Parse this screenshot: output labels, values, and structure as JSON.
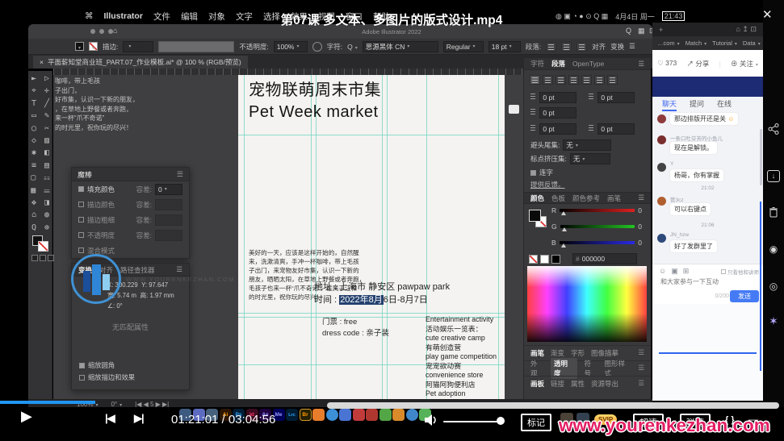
{
  "menubar": {
    "apple_icon": "⌘",
    "items": [
      "Illustrator",
      "文件",
      "编辑",
      "对象",
      "文字",
      "选择",
      "效果",
      "视图",
      "窗口",
      "帮助"
    ],
    "status_icons": "◍ ▣ ◔ ● ⊙ Q ▦",
    "status_date": "4月4日 周一",
    "status_time": "21:43"
  },
  "video": {
    "title": "第07课 多文本、多图片的版式设计.mp4",
    "app_caption": "Adobe Illustrator 2022",
    "close_icon": "✕",
    "current_time": "01:21:01",
    "time_separator": "/",
    "duration": "03:04:56",
    "marker_button": "标记",
    "svip_badge": "SVIP",
    "quality_button": "超清",
    "danmaku_button": "弹幕",
    "code_icon": "{ }",
    "minimize_icon": "—",
    "watermark": "www.yourenkezhan.com"
  },
  "player": {
    "play_icon": "▶",
    "prev_icon": "|◀",
    "next_icon": "▶|"
  },
  "illustrator": {
    "window": {
      "home_icon": "⌂",
      "search_icon": "Q",
      "layout_icon1": "▦",
      "layout_icon2": "⊡"
    },
    "control_bar": {
      "stroke_label": "描边:",
      "opacity_label": "不透明度:",
      "opacity_value": "100%",
      "char_label": "字符:",
      "font_search_icon": "Q",
      "font_name": "思源黑体 CN",
      "font_style": "Regular",
      "font_size": "18 pt",
      "paragraph_label": "段落:",
      "align_label": "对齐",
      "transform_label": "变换",
      "menu_icon": "☰"
    },
    "doc_tab": {
      "close_icon": "×",
      "title": "平面薪知堂商业班_PART.07_作业模板.ai* @ 100 % (RGB/预览)"
    },
    "tools_glyphs": "► ▷ ⌖ ✛ T ╱ ▭ ✎ ◯ ✂ ◇ ▨ ✱ ◧ ≡ ▤ ▢ ☷ ▦ ☰ ✥ ◨ ⌂ ◍ Q ⊕",
    "status_bar": {
      "zoom": "100%",
      "rotation": "0°",
      "artboard_nav": "|◀ ◀ 5 ▶ ▶|"
    },
    "magic_wand_panel": {
      "title": "魔棒",
      "rows": [
        {
          "label": "填充颜色",
          "field": "容差:",
          "value": "0"
        },
        {
          "label": "描边颜色",
          "field": "容差:"
        },
        {
          "label": "描边粗细",
          "field": "容差:"
        },
        {
          "label": "不透明度",
          "field": "容差:"
        },
        {
          "label": "混合模式"
        }
      ]
    },
    "transform_panel": {
      "tabs": [
        "变换",
        "对齐",
        "路径查找器"
      ],
      "x_label": "X:",
      "x_value": "300.229",
      "y_label": "Y:",
      "y_value": "97.647",
      "w_label": "宽:",
      "w_value": "5.74 m",
      "h_label": "高:",
      "h_value": "1.97 mm",
      "angle_label": "∠:",
      "angle_value": "0°",
      "empty_text": "无匹配属性",
      "scale_corners": "缩放圆角",
      "scale_strokes": "缩放描边和效果"
    },
    "paragraph_panel": {
      "tabs": [
        "字符",
        "段落",
        "OpenType"
      ],
      "indent_left": "0 pt",
      "indent_right": "0 pt",
      "indent_first": "0 pt",
      "space_before": "0 pt",
      "space_after": "0 pt",
      "kinsoku_label": "避头尾集:",
      "kinsoku_value": "无",
      "mojikumi_label": "标点挤压集:",
      "mojikumi_value": "无",
      "hyphenate_label": "连字",
      "feedback_link": "提供反馈。"
    },
    "color_panel": {
      "tabs": [
        "颜色",
        "色板",
        "颜色参考",
        "画笔"
      ],
      "channels": [
        {
          "label": "R",
          "value": "0"
        },
        {
          "label": "G",
          "value": "0"
        },
        {
          "label": "B",
          "value": "0"
        }
      ],
      "hex_prefix": "#",
      "hex_value": "000000"
    },
    "panel_tab_rows": [
      [
        "画笔",
        "渐变",
        "字形",
        "图像描摹"
      ],
      [
        "外观",
        "透明度",
        "符号",
        "图形样式"
      ],
      [
        "画板",
        "链接",
        "属性",
        "资源导出"
      ]
    ]
  },
  "artboard": {
    "title_line1": "宠物联萌周末市集",
    "title_line2": "Pet Week market",
    "paragraph": [
      "美好的一天，应该是这样开始的，自然醒",
      "来，洗漱清爽，手冲一杯咖啡，带上毛孩",
      "子出门，来宠物友好市集，认识一下新的",
      "朋友，晒晒太阳，在草地上野餐或者奔跑，",
      "毛孩子也来一杯“爪不奇诺”，在属于汪和",
      "的时光里，祝你玩的尽兴！"
    ],
    "address_line": "地址 : 上海市 静安区 pawpaw park",
    "time_label": "时间 :",
    "time_highlight": "2022年8月",
    "time_rest": "6日-8月7日",
    "ticket_line1": "门票 : free",
    "ticket_line2": "dress code : 亲子装",
    "entertainment": [
      "Entertainment activity",
      "活动娱乐一览表：",
      "cute creative camp",
      "有萌创造营",
      "play game competition",
      "宠宠欲动赛",
      "convenience store",
      "阿猫阿狗便利店",
      "Pet adoption"
    ],
    "pasteboard_fragment": [
      "咖啡，带上毛孩",
      "子出门，",
      "好市集，认识一下新的朋友，",
      "，在草地上野餐或者奔跑，",
      "来一杯“爪不奇诺”",
      "的时光里，祝你玩的尽兴！"
    ]
  },
  "chat": {
    "new_tab_icon": "+",
    "window_icons": "⌂ ↥ ⊡",
    "bookmarks_prefix": "…com",
    "bookmarks": [
      "Match",
      "Tutorial",
      "Data"
    ],
    "like_icon": "♡",
    "like_count": "373",
    "share_icon": "↗",
    "share_label": "分享",
    "follow_icon": "⊕",
    "follow_label": "关注",
    "tabs": [
      "聊天",
      "提问",
      "在线"
    ],
    "messages": [
      {
        "text": "那边排版开还是关",
        "emoji": "☺"
      },
      {
        "name": "一条口吐芬芳的小鱼儿",
        "text": "现在是解锁。"
      },
      {
        "name": "Y",
        "text": "杨哥，你有掌握"
      },
      {
        "time": "21:02"
      },
      {
        "name": "管3cz",
        "text": "可以右键点"
      },
      {
        "time": "21:06"
      },
      {
        "name": "JN_hzw",
        "text": "好了发群里了"
      }
    ],
    "emoji_icon": "☺",
    "image_icon": "▣",
    "more_icon": "⊞",
    "filter_label": "只看他和讲师",
    "input_placeholder": "和大家参与一下互动",
    "char_count": "0/200",
    "send_button": "发送"
  },
  "dock_apps": [
    "",
    "",
    "",
    "Ai",
    "Ps",
    "Id",
    "Ae",
    "Me",
    "Lrc",
    "Br",
    "",
    "",
    "",
    "",
    "",
    "",
    "",
    "",
    ""
  ],
  "side_toolbar": {
    "download_icon": "↓",
    "record_icon": "◉",
    "circle_icon": "◎",
    "sparkle_icon": "✶"
  },
  "watermark_logo_text": "WWW.YOURENKEZHAN.COM"
}
